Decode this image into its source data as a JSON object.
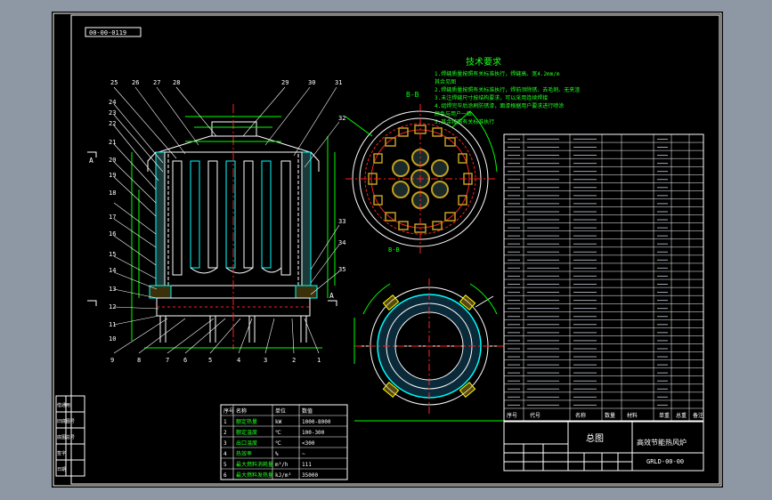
{
  "drawing_number_box": "00-00-0119",
  "balloon_numbers_top": [
    "25",
    "26",
    "27",
    "28",
    "29",
    "30",
    "31"
  ],
  "balloon_numbers_left": [
    "24",
    "23",
    "22",
    "21",
    "20",
    "19",
    "18",
    "17",
    "16",
    "15",
    "14",
    "13",
    "12",
    "11",
    "10"
  ],
  "balloon_numbers_right": [
    "32",
    "33",
    "34",
    "35"
  ],
  "balloon_numbers_bottom": [
    "9",
    "8",
    "7",
    "6",
    "5",
    "4",
    "3",
    "2",
    "1"
  ],
  "section_labels": {
    "bb": "B-B",
    "b_lower": "B-B"
  },
  "section_marks": {
    "a_left": "A",
    "a_right": "A"
  },
  "tech_title": "技术要求",
  "tech_lines": [
    "1.焊缝质量按照有关标准执行，焊缝高、宽4.2mm/m",
    "  其余见图",
    "2.焊缝质量按照有关标准执行，焊前须除锈、去毛刺、无夹渣",
    "3.未注焊缝尺寸按结构要求，可以采用连续焊接",
    "4.组焊完毕后涂刷防锈漆，面漆根据用户要求进行喷涂",
    "  颜色与用户一致",
    "5.其余按照有关标准执行"
  ],
  "param_table": {
    "headers": [
      "序号",
      "名称",
      "单位",
      "数值"
    ],
    "rows": [
      [
        "1",
        "额定热量",
        "kW",
        "1000-8000"
      ],
      [
        "2",
        "额定温度",
        "℃",
        "100-300"
      ],
      [
        "3",
        "出口温度",
        "℃",
        "<300"
      ],
      [
        "4",
        "热效率",
        "%",
        "~"
      ],
      [
        "5",
        "最大燃料消耗量",
        "m³/h",
        "111"
      ],
      [
        "6",
        "最大燃料发热量",
        "kJ/m³",
        "35000"
      ]
    ]
  },
  "parts_header": [
    "序号",
    "代号",
    "名称",
    "数量",
    "材料",
    "单重",
    "总重",
    "备注"
  ],
  "title_block": {
    "name": "总图",
    "product": "高效节能热风炉",
    "code": "GRLD-00-00"
  },
  "left_strip": [
    "借通用",
    "旧底图号",
    "底图总号",
    "签字",
    "日期"
  ],
  "colors": {
    "background": "#000000",
    "frame": "#ffffff",
    "outline": "#ffffff",
    "cyan": "#00ffff",
    "red": "#ff2020",
    "green": "#20ff20",
    "yellow": "#ffff00",
    "gray": "#9aa3b0"
  }
}
